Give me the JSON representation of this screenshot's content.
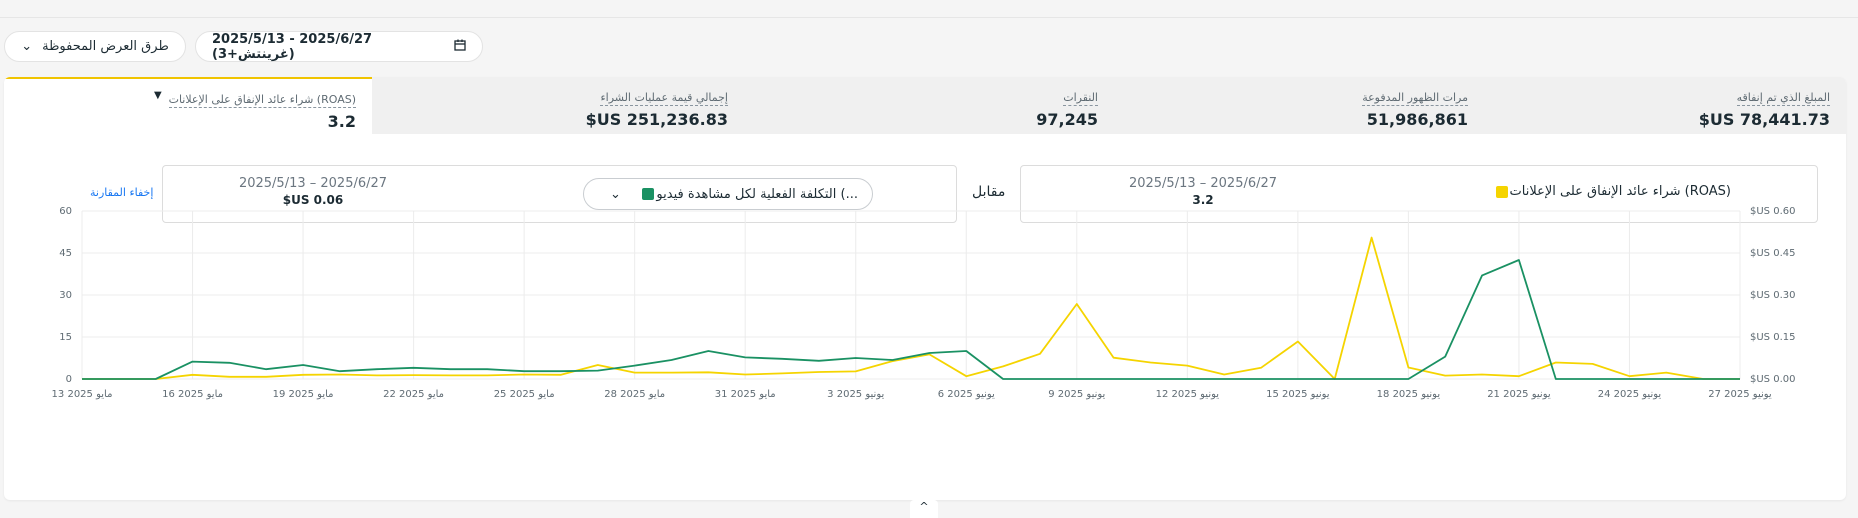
{
  "header": {
    "saved_views_label": "طرق العرض المحفوظة",
    "date_range_label": "2025/5/13 - 2025/6/27 (غرينتش+3)"
  },
  "tabs": [
    {
      "label": "المبلغ الذي تم إنفاقه",
      "value": "$US 78,441.73"
    },
    {
      "label": "مرات الظهور المدفوعة",
      "value": "51,986,861"
    },
    {
      "label": "النقرات",
      "value": "97,245"
    },
    {
      "label": "إجمالي قيمة عمليات الشراء",
      "value": "$US 251,236.83"
    },
    {
      "label": "شراء عائد الإنفاق على الإعلانات (ROAS)",
      "value": "3.2"
    }
  ],
  "compare": {
    "primary": {
      "name": "شراء عائد الإنفاق على الإعلانات (ROAS)",
      "range": "2025/5/13 – 2025/6/27",
      "value": "3.2",
      "color": "#f5d400"
    },
    "vs_label": "مقابل",
    "secondary": {
      "name": "التكلفة الفعلية لكل مشاهدة فيديو (...",
      "range": "2025/5/13 – 2025/6/27",
      "value": "$US 0.06",
      "color": "#1a9163"
    },
    "hide_label": "إخفاء المقارنة"
  },
  "chart_data": {
    "type": "line",
    "x": [
      "13 مايو 2025",
      "14",
      "15",
      "16 مايو 2025",
      "17",
      "18",
      "19 مايو 2025",
      "20",
      "21",
      "22 مايو 2025",
      "23",
      "24",
      "25 مايو 2025",
      "26",
      "27",
      "28 مايو 2025",
      "29",
      "30",
      "31 مايو 2025",
      "1",
      "2",
      "3 يونيو 2025",
      "4",
      "5",
      "6 يونيو 2025",
      "7",
      "8",
      "9 يونيو 2025",
      "10",
      "11",
      "12 يونيو 2025",
      "13",
      "14",
      "15 يونيو 2025",
      "16",
      "17",
      "18 يونيو 2025",
      "19",
      "20",
      "21 يونيو 2025",
      "22",
      "23",
      "24 يونيو 2025",
      "25",
      "26",
      "27 يونيو 2025"
    ],
    "x_tick_labels": [
      "13 مايو 2025",
      "16 مايو 2025",
      "19 مايو 2025",
      "22 مايو 2025",
      "25 مايو 2025",
      "28 مايو 2025",
      "31 مايو 2025",
      "3 يونيو 2025",
      "6 يونيو 2025",
      "9 يونيو 2025",
      "12 يونيو 2025",
      "15 يونيو 2025",
      "18 يونيو 2025",
      "21 يونيو 2025",
      "24 يونيو 2025",
      "27 يونيو 2025"
    ],
    "left_ticks": [
      "0",
      "15",
      "30",
      "45",
      "60"
    ],
    "right_ticks": [
      "$US 0.00",
      "$US 0.15",
      "$US 0.30",
      "$US 0.45",
      "$US 0.60"
    ],
    "ylim_left": [
      0,
      60
    ],
    "ylim_right": [
      0,
      0.6
    ],
    "grid": true,
    "series": [
      {
        "name": "شراء عائد الإنفاق على الإعلانات (ROAS)",
        "axis": "left",
        "color": "#f5d400",
        "values": [
          0,
          0,
          0,
          1.5,
          0.8,
          0.8,
          1.5,
          1.6,
          1.3,
          1.4,
          1.3,
          1.3,
          1.6,
          1.5,
          5,
          2.3,
          2.3,
          2.4,
          1.6,
          2,
          2.5,
          2.7,
          6.4,
          8.8,
          1,
          4.5,
          9,
          26.8,
          7.6,
          5.9,
          4.8,
          1.6,
          4,
          13.4,
          0,
          50.5,
          4.1,
          1.2,
          1.6,
          1,
          5.9,
          5.4,
          1,
          2.3,
          0,
          0
        ]
      },
      {
        "name": "التكلفة الفعلية لكل مشاهدة فيديو (...",
        "axis": "right",
        "color": "#1a9163",
        "values": [
          0,
          0,
          0,
          0.062,
          0.058,
          0.035,
          0.05,
          0.028,
          0.035,
          0.04,
          0.035,
          0.035,
          0.028,
          0.028,
          0.03,
          0.048,
          0.068,
          0.1,
          0.077,
          0.072,
          0.065,
          0.075,
          0.068,
          0.093,
          0.1,
          0,
          0,
          0,
          0,
          0,
          0,
          0,
          0,
          0,
          0,
          0,
          0,
          0.08,
          0.37,
          0.425,
          0,
          0,
          0,
          0,
          0,
          0
        ]
      }
    ]
  }
}
